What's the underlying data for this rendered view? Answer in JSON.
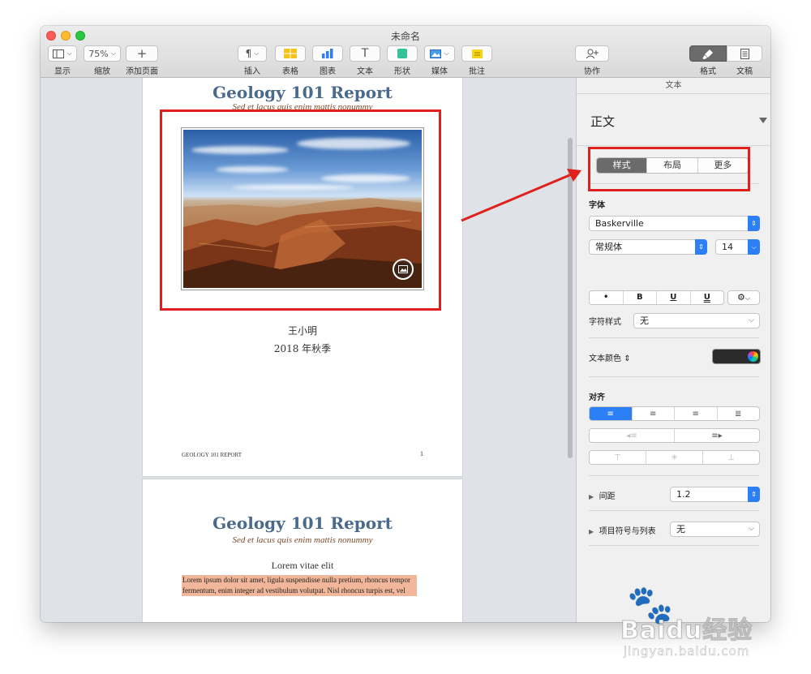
{
  "window": {
    "title": "未命名"
  },
  "toolbar": {
    "view_label": "显示",
    "zoom_value": "75%",
    "zoom_label": "缩放",
    "add_page_label": "添加页面",
    "insert_label": "插入",
    "table_label": "表格",
    "chart_label": "图表",
    "text_label": "文本",
    "shape_label": "形状",
    "media_label": "媒体",
    "comment_label": "批注",
    "collaborate_label": "协作",
    "format_label": "格式",
    "document_label": "文稿"
  },
  "document": {
    "page1": {
      "title": "Geology 101 Report",
      "subtitle": "Sed et lacus quis enim mattis nonummy",
      "author": "王小明",
      "term": "2018 年秋季",
      "footer_left": "GEOLOGY 101 REPORT",
      "footer_right": "1"
    },
    "page2": {
      "title": "Geology 101 Report",
      "subtitle": "Sed et lacus quis enim mattis nonummy",
      "heading": "Lorem vitae elit",
      "paragraph": "Lorem ipsum dolor sit amet, ligula suspendisse nulla pretium, rhoncus tempor fermentum, enim integer ad vestibulum volutpat. Nisl rhoncus turpis est, vel"
    }
  },
  "inspector": {
    "header": "文本",
    "paragraph_style": "正文",
    "tabs": [
      "样式",
      "布局",
      "更多"
    ],
    "font_section": "字体",
    "font_family": "Baskerville",
    "font_typeface": "常规体",
    "font_size": "14",
    "format_buttons": [
      "•",
      "B",
      "U",
      "U"
    ],
    "char_style_label": "字符样式",
    "char_style_value": "无",
    "text_color_label": "文本颜色",
    "text_color": "#2b2b2b",
    "align_section": "对齐",
    "spacing_label": "间距",
    "spacing_value": "1.2",
    "bullets_label": "项目符号与列表",
    "bullets_value": "无"
  },
  "watermark": {
    "text": "Baidu经验",
    "url": "jingyan.baidu.com"
  },
  "colors": {
    "title_blue": "#4a6a8c",
    "accent_blue": "#2d7ff5",
    "annotation_red": "#e0201c"
  }
}
